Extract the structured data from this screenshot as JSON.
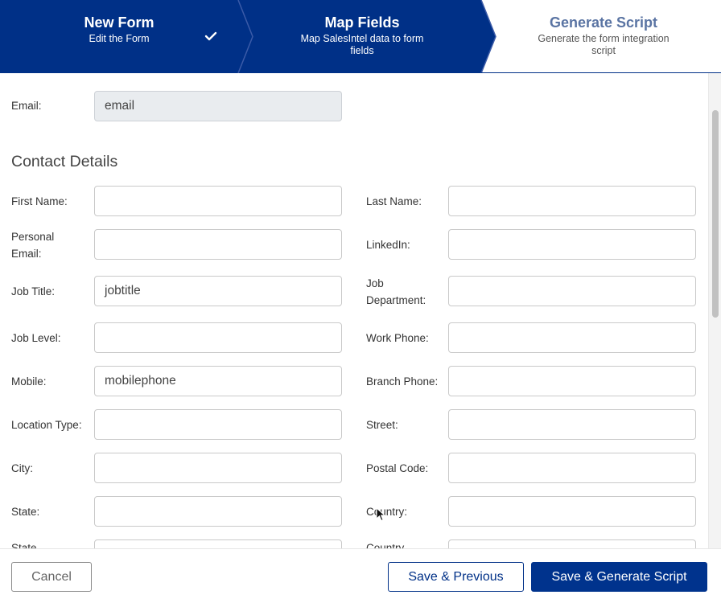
{
  "stepper": {
    "steps": [
      {
        "title": "New Form",
        "subtitle": "Edit the Form",
        "state": "complete"
      },
      {
        "title": "Map Fields",
        "subtitle": "Map SalesIntel data to form fields",
        "state": "complete"
      },
      {
        "title": "Generate Script",
        "subtitle": "Generate the form integration script",
        "state": "current"
      }
    ],
    "colors": {
      "active": "#003087",
      "inactive": "#ffffff",
      "divider": "#3b5ba8"
    }
  },
  "email_row": {
    "label": "Email:",
    "value": "email"
  },
  "contact_section": {
    "title": "Contact Details",
    "left_fields": [
      {
        "label": "First Name:",
        "value": ""
      },
      {
        "label": "Personal Email:",
        "value": ""
      },
      {
        "label": "Job Title:",
        "value": "jobtitle"
      },
      {
        "label": "Job Level:",
        "value": ""
      },
      {
        "label": "Mobile:",
        "value": "mobilephone"
      },
      {
        "label": "Location Type:",
        "value": ""
      },
      {
        "label": "City:",
        "value": ""
      },
      {
        "label": "State:",
        "value": ""
      },
      {
        "label": "State",
        "value": ""
      }
    ],
    "right_fields": [
      {
        "label": "Last Name:",
        "value": ""
      },
      {
        "label": "LinkedIn:",
        "value": ""
      },
      {
        "label": "Job Department:",
        "value": ""
      },
      {
        "label": "Work Phone:",
        "value": ""
      },
      {
        "label": "Branch Phone:",
        "value": ""
      },
      {
        "label": "Street:",
        "value": ""
      },
      {
        "label": "Postal Code:",
        "value": ""
      },
      {
        "label": "Country:",
        "value": ""
      },
      {
        "label": "Country",
        "value": ""
      }
    ]
  },
  "footer": {
    "cancel_label": "Cancel",
    "previous_label": "Save & Previous",
    "generate_label": "Save & Generate Script"
  }
}
